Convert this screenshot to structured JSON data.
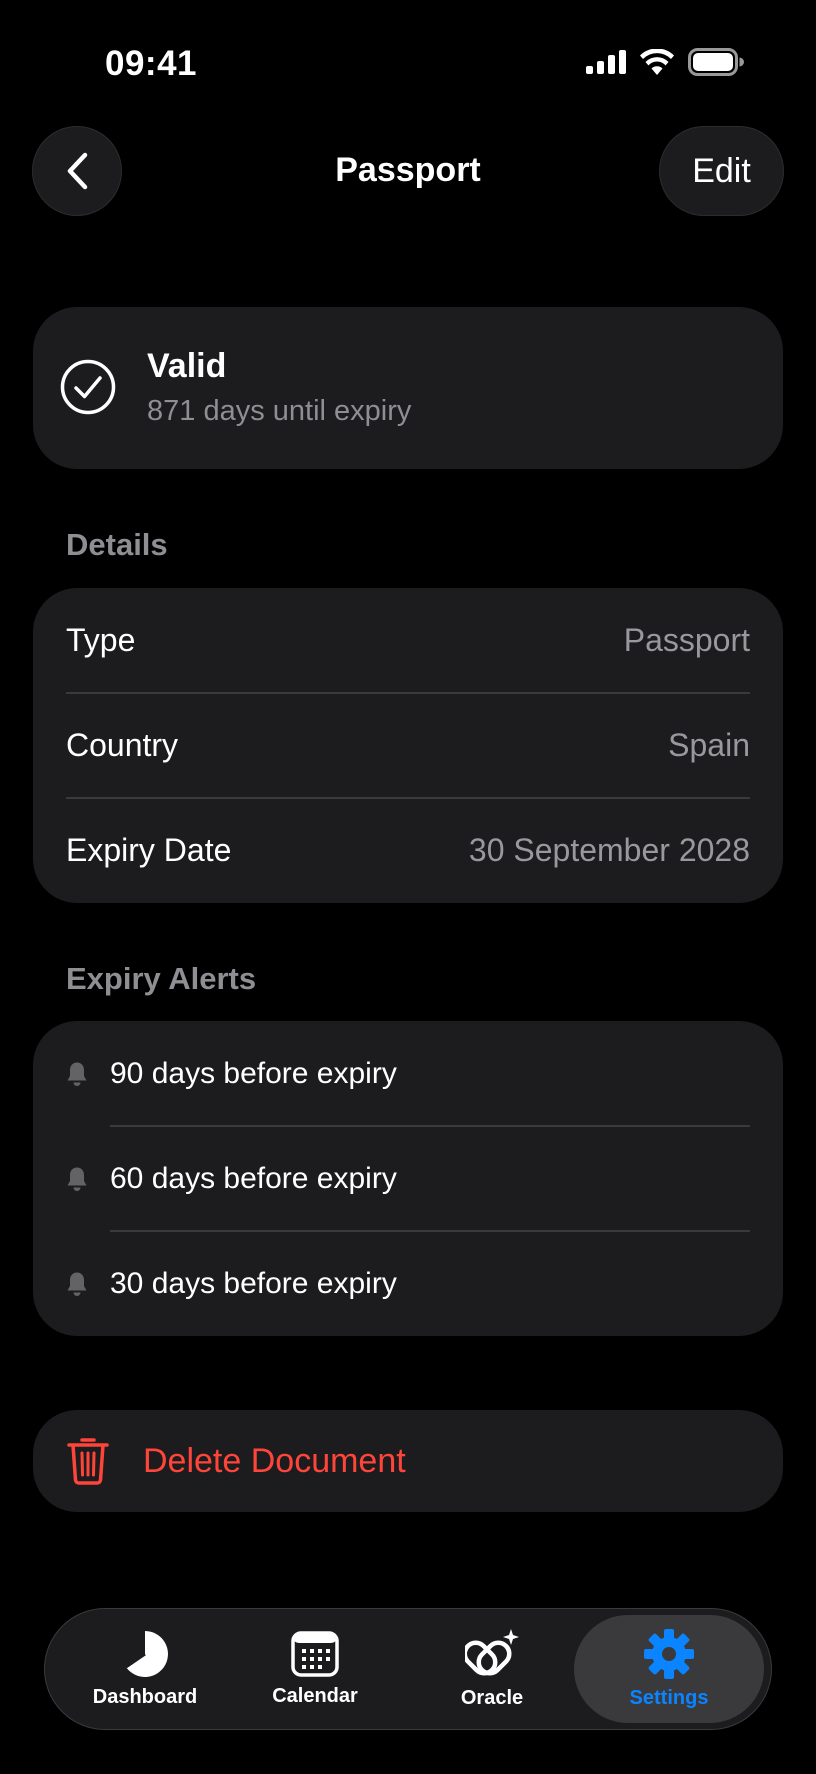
{
  "status_bar": {
    "time": "09:41"
  },
  "header": {
    "title": "Passport",
    "edit_label": "Edit"
  },
  "status": {
    "title": "Valid",
    "subtitle": "871 days until expiry"
  },
  "details": {
    "header": "Details",
    "rows": [
      {
        "label": "Type",
        "value": "Passport"
      },
      {
        "label": "Country",
        "value": "Spain"
      },
      {
        "label": "Expiry Date",
        "value": "30 September 2028"
      }
    ]
  },
  "alerts": {
    "header": "Expiry Alerts",
    "items": [
      {
        "label": "90 days before expiry"
      },
      {
        "label": "60 days before expiry"
      },
      {
        "label": "30 days before expiry"
      }
    ]
  },
  "delete": {
    "label": "Delete Document",
    "color": "#ff453a"
  },
  "tabbar": {
    "active_color": "#0a84ff",
    "tabs": [
      {
        "label": "Dashboard",
        "icon": "pie-chart-icon"
      },
      {
        "label": "Calendar",
        "icon": "calendar-icon"
      },
      {
        "label": "Oracle",
        "icon": "sparkle-link-icon"
      },
      {
        "label": "Settings",
        "icon": "gear-icon",
        "active": true
      }
    ]
  }
}
